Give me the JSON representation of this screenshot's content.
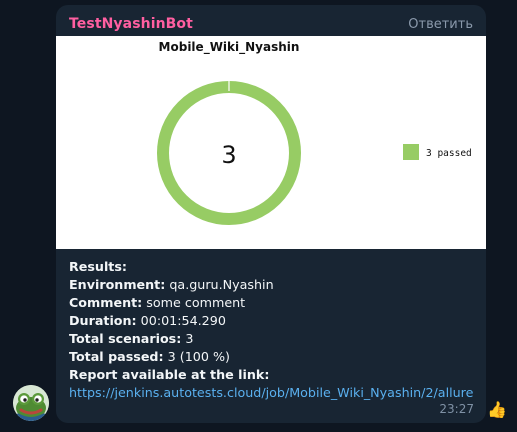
{
  "message": {
    "sender": "TestNyashinBot",
    "reply_label": "Ответить",
    "time": "23:27",
    "reaction": "👍",
    "avatar_icon": "frog-avatar-icon"
  },
  "report": {
    "results_label": "Results:",
    "environment_label": "Environment:",
    "environment_value": "qa.guru.Nyashin",
    "comment_label": "Comment:",
    "comment_value": "some comment",
    "duration_label": "Duration:",
    "duration_value": "00:01:54.290",
    "scenarios_label": "Total scenarios:",
    "scenarios_value": "3",
    "passed_label": "Total passed:",
    "passed_value": "3 (100 %)",
    "link_label": "Report available at the link:",
    "link_value": "https://jenkins.autotests.cloud/job/Mobile_Wiki_Nyashin/2/allure"
  },
  "chart_data": {
    "type": "pie",
    "title": "Mobile_Wiki_Nyashin",
    "center_label": "3",
    "series": [
      {
        "name": "3 passed",
        "value": 3,
        "color": "#97cc64"
      }
    ],
    "legend_position": "right"
  },
  "colors": {
    "background": "#0e1621",
    "bubble": "#182533",
    "sender": "#ff5fa1",
    "link": "#5ab0ef",
    "passed": "#97cc64"
  }
}
